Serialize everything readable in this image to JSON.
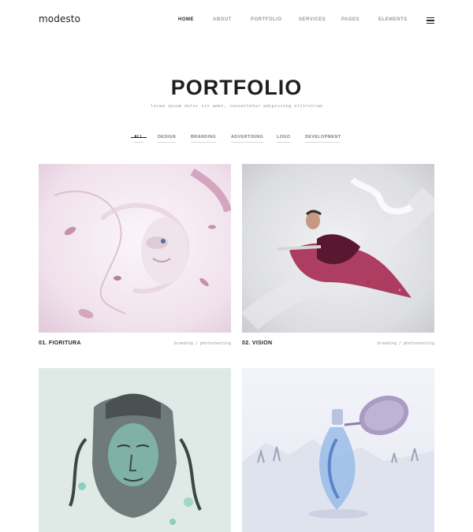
{
  "header": {
    "logo": "modesto",
    "nav": [
      {
        "label": "HOME",
        "active": true
      },
      {
        "label": "ABOUT",
        "active": false
      },
      {
        "label": "PORTFOLIO",
        "active": false
      },
      {
        "label": "SERVICES",
        "active": false
      },
      {
        "label": "PAGES",
        "active": false
      },
      {
        "label": "ELEMENTS",
        "active": false
      }
    ],
    "menu_icon": "hamburger-icon"
  },
  "hero": {
    "title": "PORTFOLIO",
    "subtitle": "lorem ipsum dolor sit amet, consectetur adipiscing elitrutrum"
  },
  "filters": [
    {
      "label": "ALL",
      "active": true
    },
    {
      "label": "DESIGN",
      "active": false
    },
    {
      "label": "BRANDING",
      "active": false
    },
    {
      "label": "ADVERTISING",
      "active": false
    },
    {
      "label": "LOGO",
      "active": false
    },
    {
      "label": "DEVELOPMENT",
      "active": false
    }
  ],
  "projects": [
    {
      "title": "01. FIORITURA",
      "tags": "branding / photoshooting",
      "image": "flower-face-artwork"
    },
    {
      "title": "02. VISION",
      "tags": "branding / photoshooting",
      "image": "warrior-artwork"
    },
    {
      "title": "",
      "tags": "",
      "image": "stone-buddha-artwork"
    },
    {
      "title": "",
      "tags": "",
      "image": "perfume-bottle-artwork"
    }
  ],
  "colors": {
    "text_dark": "#222222",
    "text_muted": "#9a9a9a",
    "background": "#ffffff",
    "divider": "#d9d9d9"
  }
}
